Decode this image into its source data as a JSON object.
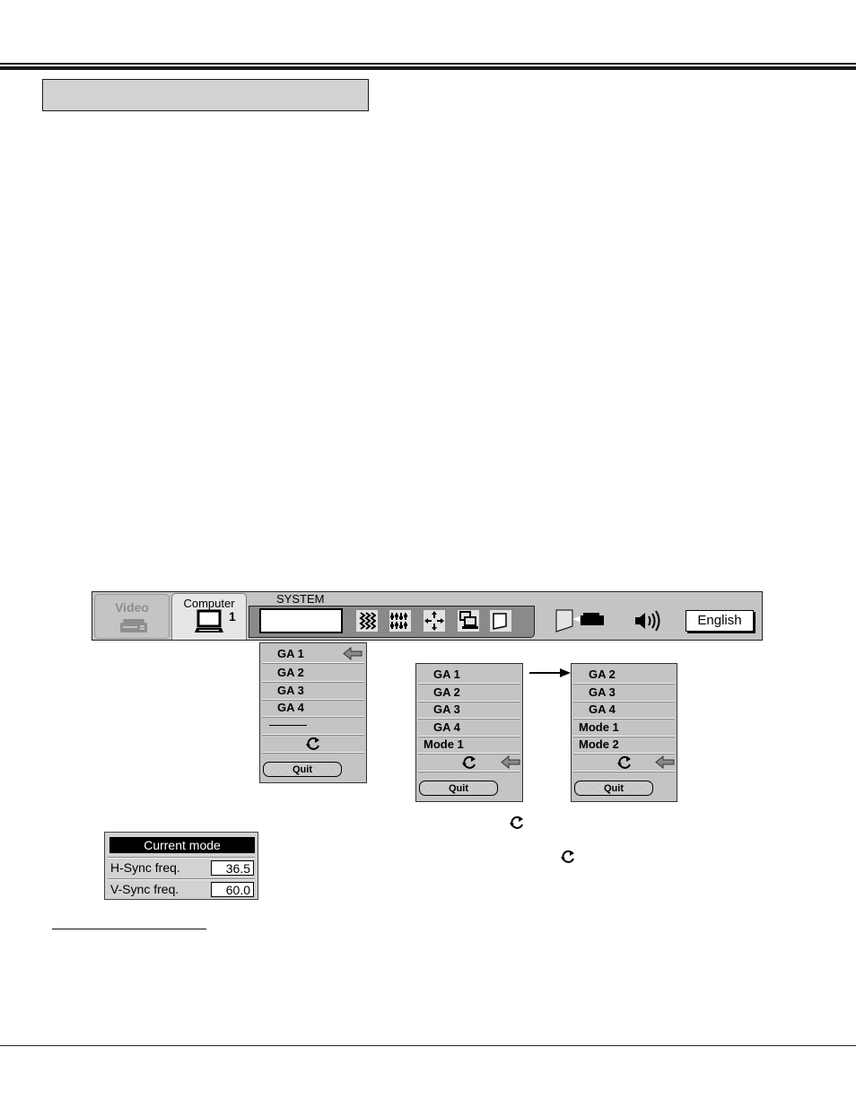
{
  "page": {
    "title_box_text": ""
  },
  "menubar": {
    "tabs": [
      {
        "label": "Video",
        "icon": "vcr-icon",
        "state": "disabled"
      },
      {
        "label": "Computer",
        "number": "1",
        "icon": "computer-icon",
        "state": "selected"
      }
    ],
    "system_label": "SYSTEM",
    "system_field_value": "",
    "tool_icons": [
      "image-adjust-icon",
      "pc-adjust-icon",
      "position-icon",
      "pc-system-icon",
      "screen-icon"
    ],
    "right_icons": [
      "projector-screen-icon",
      "sound-icon"
    ],
    "language_button": "English"
  },
  "menu_left": {
    "items": [
      "GA 1",
      "GA 2",
      "GA 3",
      "GA 4",
      "———"
    ],
    "selected_index": 0,
    "quit_label": "Quit"
  },
  "menu_middle": {
    "items": [
      "GA 1",
      "GA 2",
      "GA 3",
      "GA 4",
      "Mode 1"
    ],
    "quit_label": "Quit"
  },
  "menu_right": {
    "items": [
      "GA 2",
      "GA 3",
      "GA 4",
      "Mode 1",
      "Mode 2"
    ],
    "quit_label": "Quit"
  },
  "current_mode": {
    "header": "Current mode",
    "rows": [
      {
        "label": "H-Sync freq.",
        "value": "36.5"
      },
      {
        "label": "V-Sync freq.",
        "value": "60.0"
      }
    ]
  }
}
